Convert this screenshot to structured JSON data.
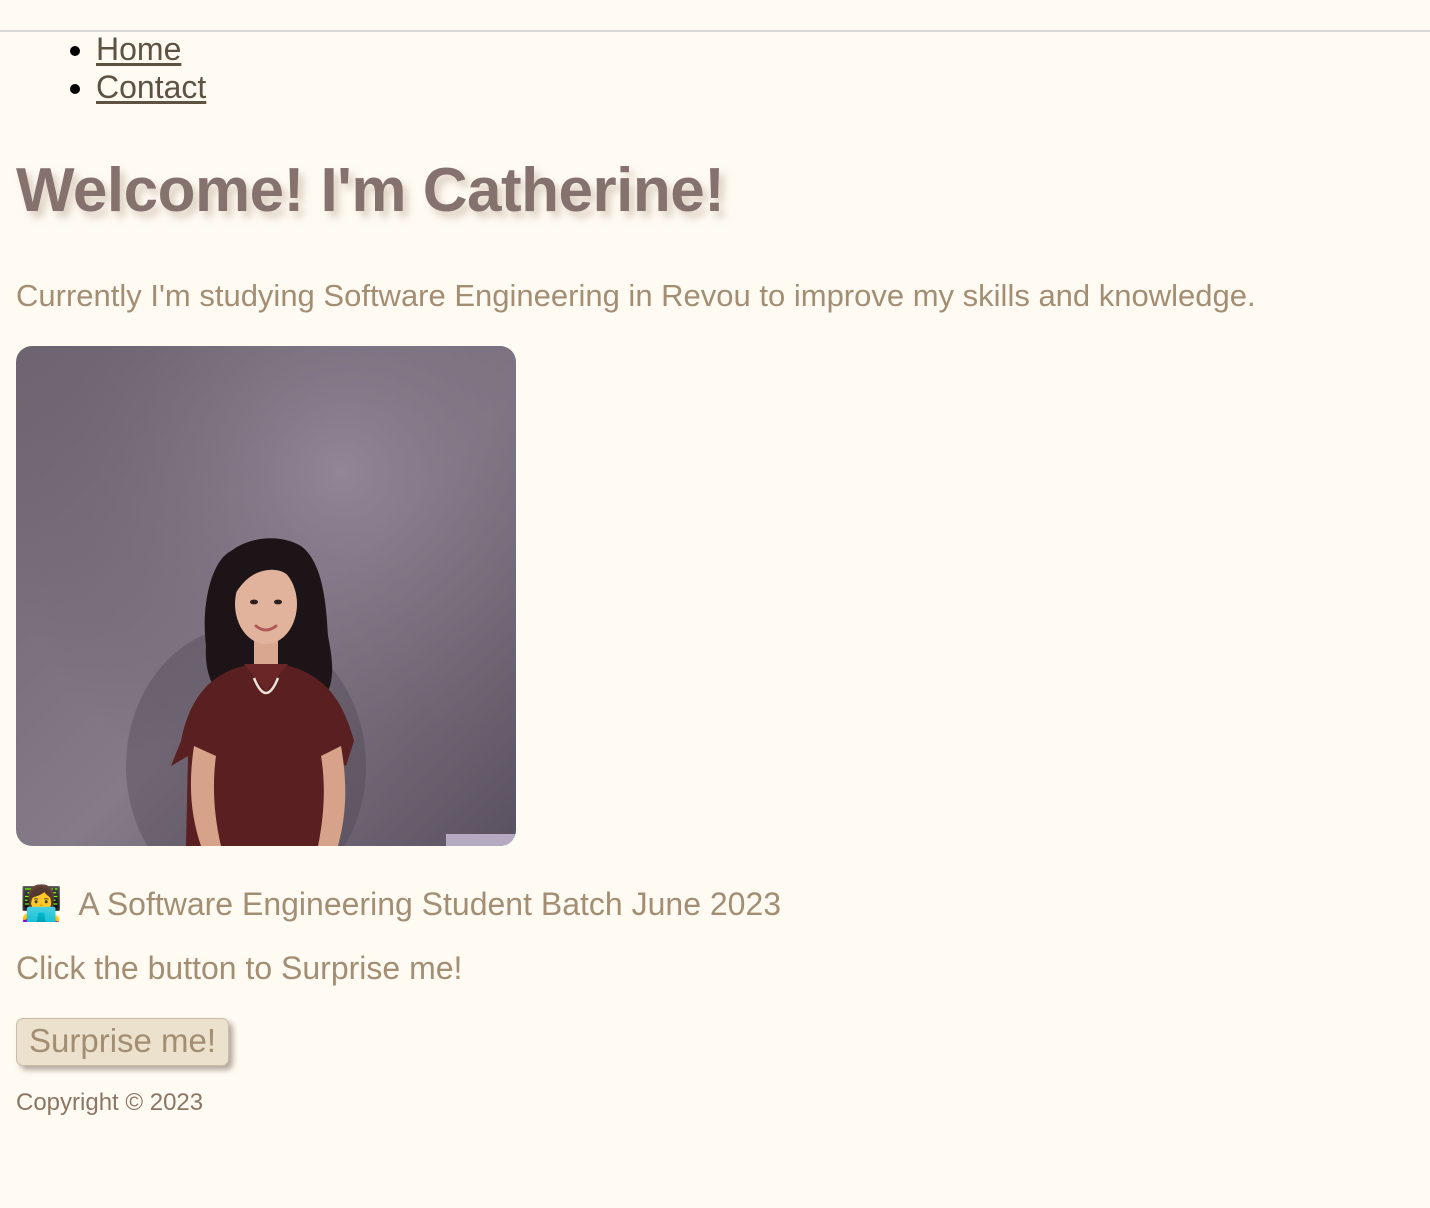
{
  "nav": {
    "items": [
      {
        "label": "Home"
      },
      {
        "label": "Contact"
      }
    ]
  },
  "hero": {
    "title": "Welcome! I'm Catherine!",
    "intro": "Currently I'm studying Software Engineering in Revou to improve my skills and knowledge."
  },
  "profile": {
    "photo_alt": "Portrait of Catherine",
    "batch_emoji": "👩‍💻",
    "batch_text": "A Software Engineering Student Batch June 2023"
  },
  "cta": {
    "prompt": "Click the button to Surprise me!",
    "button_label": "Surprise me!"
  },
  "footer": {
    "copyright": "Copyright © 2023"
  },
  "colors": {
    "background": "#fffbf3",
    "title": "#85726e",
    "body_text": "#a38e74",
    "link": "#5e5242",
    "button_bg": "#ece1cc"
  }
}
